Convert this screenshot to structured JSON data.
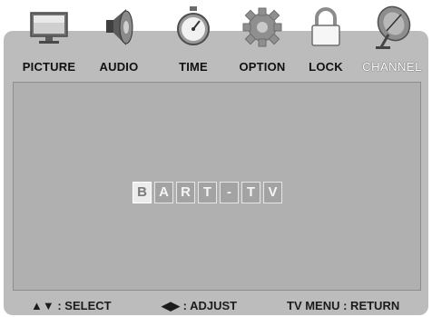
{
  "tabs": [
    {
      "label": "PICTURE",
      "icon": "monitor-icon"
    },
    {
      "label": "AUDIO",
      "icon": "speaker-icon"
    },
    {
      "label": "TIME",
      "icon": "stopwatch-icon"
    },
    {
      "label": "OPTION",
      "icon": "gear-icon"
    },
    {
      "label": "LOCK",
      "icon": "padlock-icon"
    },
    {
      "label": "CHANNEL",
      "icon": "satellite-dish-icon",
      "active": true
    }
  ],
  "name_editor": {
    "characters": [
      "B",
      "A",
      "R",
      "T",
      "-",
      "T",
      "V"
    ],
    "selected_index": 0
  },
  "footer": {
    "select": "▲▼ : SELECT",
    "adjust": "◀▶ : ADJUST",
    "return": "TV MENU : RETURN"
  }
}
